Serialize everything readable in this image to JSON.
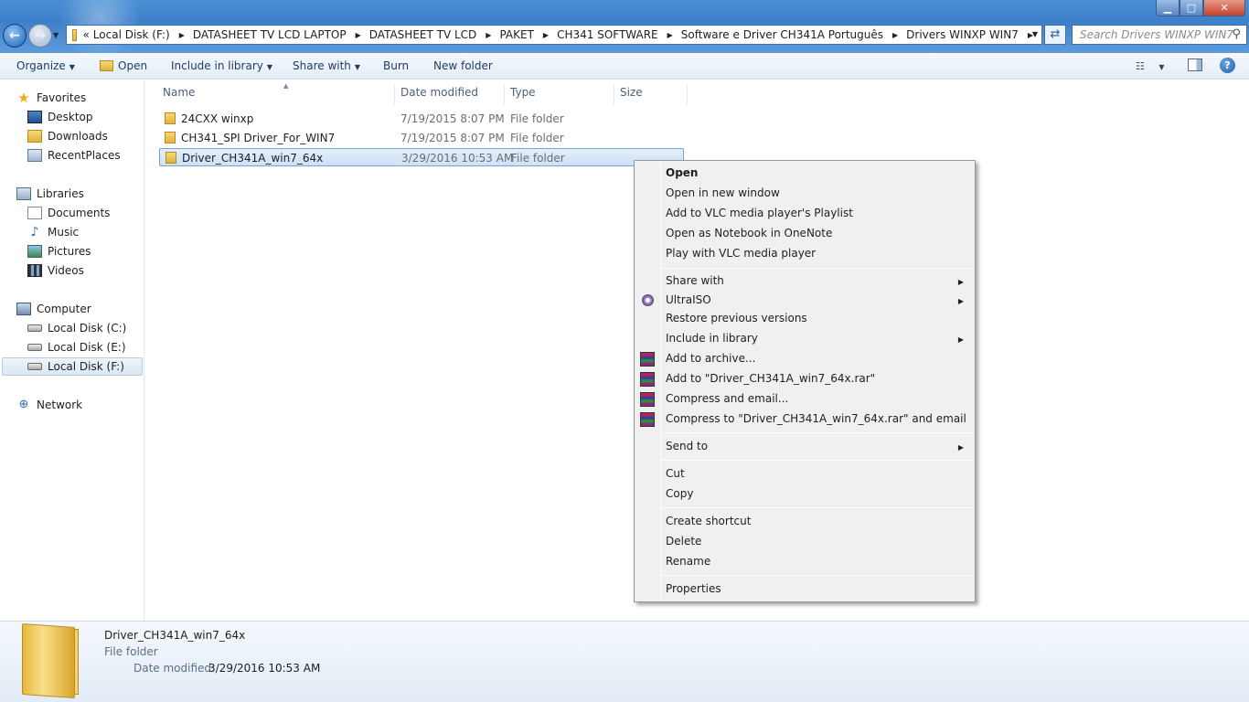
{
  "window": {
    "minimize": "▁",
    "maximize": "□",
    "close": "✕"
  },
  "address": {
    "overflow": "«",
    "crumbs": [
      "Local Disk (F:)",
      "DATASHEET TV LCD LAPTOP",
      "DATASHEET TV LCD",
      "PAKET",
      "CH341 SOFTWARE",
      "Software e Driver CH341A Português",
      "Drivers WINXP WIN7"
    ],
    "search_placeholder": "Search Drivers WINXP WIN7"
  },
  "toolbar": {
    "organize": "Organize",
    "open": "Open",
    "include_in_library": "Include in library",
    "share_with": "Share with",
    "burn": "Burn",
    "new_folder": "New folder"
  },
  "nav": {
    "favorites": "Favorites",
    "desktop": "Desktop",
    "downloads": "Downloads",
    "recent": "RecentPlaces",
    "libraries": "Libraries",
    "documents": "Documents",
    "music": "Music",
    "pictures": "Pictures",
    "videos": "Videos",
    "computer": "Computer",
    "disk_c": "Local Disk (C:)",
    "disk_e": "Local Disk (E:)",
    "disk_f": "Local Disk (F:)",
    "network": "Network"
  },
  "columns": {
    "name": "Name",
    "date": "Date modified",
    "type": "Type",
    "size": "Size"
  },
  "files": [
    {
      "name": "24CXX winxp",
      "date": "7/19/2015 8:07 PM",
      "type": "File folder"
    },
    {
      "name": "CH341_SPI Driver_For_WIN7",
      "date": "7/19/2015 8:07 PM",
      "type": "File folder"
    },
    {
      "name": "Driver_CH341A_win7_64x",
      "date": "3/29/2016 10:53 AM",
      "type": "File folder"
    }
  ],
  "menu": {
    "open": "Open",
    "open_new_window": "Open in new window",
    "vlc_playlist": "Add to VLC media player's Playlist",
    "onenote": "Open as Notebook in OneNote",
    "vlc_play": "Play with VLC media player",
    "share_with": "Share with",
    "ultraiso": "UltraISO",
    "restore": "Restore previous versions",
    "include_library": "Include in library",
    "add_archive": "Add to archive...",
    "add_rar": "Add to \"Driver_CH341A_win7_64x.rar\"",
    "compress_email": "Compress and email...",
    "compress_rar_email": "Compress to \"Driver_CH341A_win7_64x.rar\" and email",
    "send_to": "Send to",
    "cut": "Cut",
    "copy": "Copy",
    "create_shortcut": "Create shortcut",
    "delete": "Delete",
    "rename": "Rename",
    "properties": "Properties"
  },
  "details": {
    "name": "Driver_CH341A_win7_64x",
    "type": "File folder",
    "modified_label": "Date modified:",
    "modified_value": "3/29/2016 10:53 AM"
  }
}
